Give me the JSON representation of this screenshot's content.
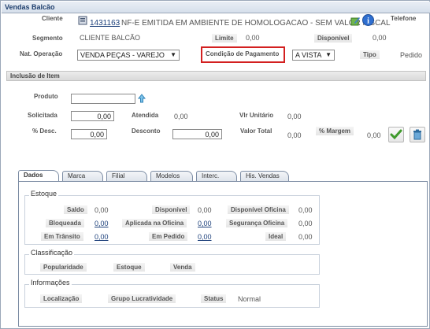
{
  "window": {
    "title": "Vendas Balcão"
  },
  "header": {
    "cliente_label": "Cliente",
    "cliente_code": "1431163",
    "cliente_name": "NF-E EMITIDA EM AMBIENTE DE HOMOLOGACAO - SEM VALOR FISCAL",
    "telefone_label": "Telefone",
    "segmento_label": "Segmento",
    "segmento_value": "CLIENTE BALCÃO",
    "limite_label": "Limite",
    "limite_value": "0,00",
    "disponivel_label": "Disponível",
    "disponivel_value": "0,00",
    "nat_operacao_label": "Nat. Operação",
    "nat_operacao_value": "VENDA PEÇAS - VAREJO",
    "condicao_label": "Condição de Pagamento",
    "condicao_value": "A VISTA",
    "tipo_label": "Tipo",
    "tipo_value": "Pedido",
    "highlight_color": "#d32020"
  },
  "inclusao": {
    "title": "Inclusão de Item",
    "produto_label": "Produto",
    "produto_value": "",
    "solicitada_label": "Solicitada",
    "solicitada_value": "0,00",
    "atendida_label": "Atendida",
    "atendida_value": "0,00",
    "vlr_unitario_label": "Vlr Unitário",
    "vlr_unitario_value": "0,00",
    "desc_pct_label": "% Desc.",
    "desc_pct_value": "0,00",
    "desconto_label": "Desconto",
    "desconto_value": "0,00",
    "valor_total_label": "Valor Total",
    "valor_total_value": "0,00",
    "margem_label": "% Margem",
    "margem_value": "0,00"
  },
  "tabs": [
    {
      "label": "Dados",
      "active": true
    },
    {
      "label": "Marca"
    },
    {
      "label": "Filial"
    },
    {
      "label": "Modelos"
    },
    {
      "label": "Interc."
    },
    {
      "label": "His. Vendas"
    }
  ],
  "estoque": {
    "title": "Estoque",
    "saldo_label": "Saldo",
    "saldo_value": "0,00",
    "disponivel_label": "Disponível",
    "disponivel_value": "0,00",
    "disp_oficina_label": "Disponível Oficina",
    "disp_oficina_value": "0,00",
    "bloqueada_label": "Bloqueada",
    "bloqueada_value": "0,00",
    "aplicada_label": "Aplicada na Oficina",
    "aplicada_value": "0,00",
    "seguranca_label": "Segurança Oficina",
    "seguranca_value": "0,00",
    "transito_label": "Em Trânsito",
    "transito_value": "0,00",
    "pedido_label": "Em Pedido",
    "pedido_value": "0,00",
    "ideal_label": "Ideal",
    "ideal_value": "0,00"
  },
  "classificacao": {
    "title": "Classificação",
    "popularidade_label": "Popularidade",
    "estoque_label": "Estoque",
    "venda_label": "Venda"
  },
  "informacoes": {
    "title": "Informações",
    "localizacao_label": "Localização",
    "grupo_label": "Grupo Lucratividade",
    "status_label": "Status",
    "status_value": "Normal"
  }
}
